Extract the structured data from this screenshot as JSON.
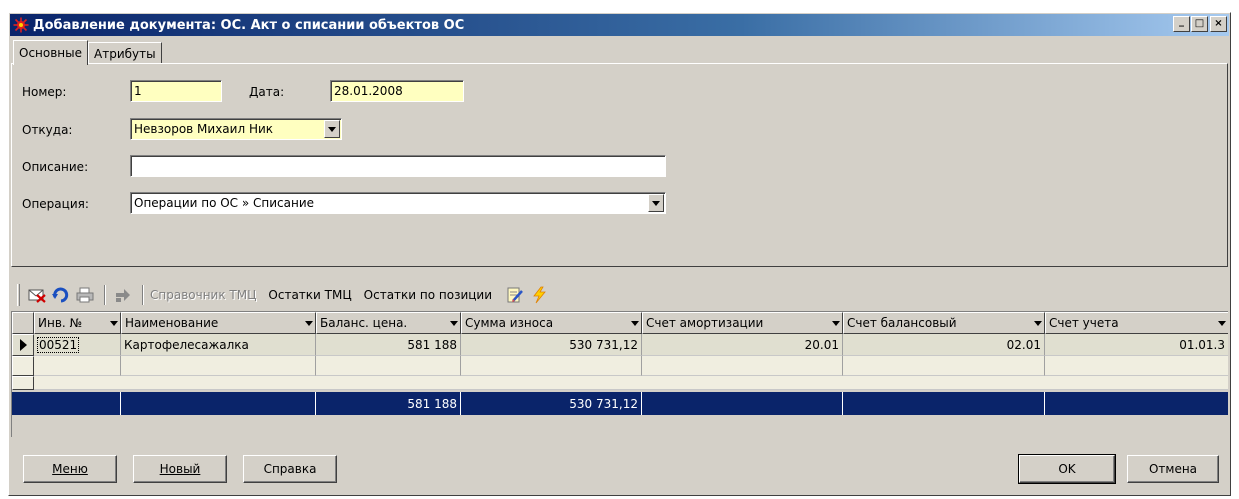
{
  "window": {
    "title": "Добавление документа: ОС. Акт о списании объектов ОС",
    "controls": {
      "minimize": "_",
      "maximize": "□",
      "close": "×"
    }
  },
  "tabs": [
    {
      "label": "Основные",
      "active": true
    },
    {
      "label": "Атрибуты",
      "active": false
    }
  ],
  "form": {
    "number_label": "Номер:",
    "number_value": "1",
    "date_label": "Дата:",
    "date_value": "28.01.2008",
    "from_label": "Откуда:",
    "from_value": "Невзоров  Михаил  Ник",
    "description_label": "Описание:",
    "description_value": "",
    "operation_label": "Операция:",
    "operation_value": "Операции по ОС » Списание"
  },
  "toolbar": {
    "icons": [
      "delete-document-icon",
      "refresh-icon",
      "print-icon",
      "move-icon"
    ],
    "items": [
      {
        "label": "Справочник ТМЦ",
        "enabled": false
      },
      {
        "label": "Остатки ТМЦ",
        "enabled": true
      },
      {
        "label": "Остатки по позиции",
        "enabled": true
      }
    ],
    "trailing_icons": [
      "edit-document-icon",
      "lightning-icon"
    ]
  },
  "grid": {
    "columns": [
      "Инв. №",
      "Наименование",
      "Баланс. цена.",
      "Сумма износа",
      "Счет амортизации",
      "Счет балансовый",
      "Счет учета"
    ],
    "rows": [
      [
        "00521",
        "Картофелесажалка",
        "581 188",
        "530 731,12",
        "20.01",
        "02.01",
        "01.01.3"
      ]
    ],
    "totals": [
      "",
      "",
      "581 188",
      "530 731,12",
      "",
      "",
      ""
    ]
  },
  "buttons": {
    "menu": "Меню",
    "new": "Новый",
    "help": "Справка",
    "ok": "OK",
    "cancel": "Отмена"
  },
  "colors": {
    "title_start": "#0a246a",
    "title_end": "#a6caf0",
    "required_field": "#ffffc0",
    "totals_row": "#0a246a"
  }
}
